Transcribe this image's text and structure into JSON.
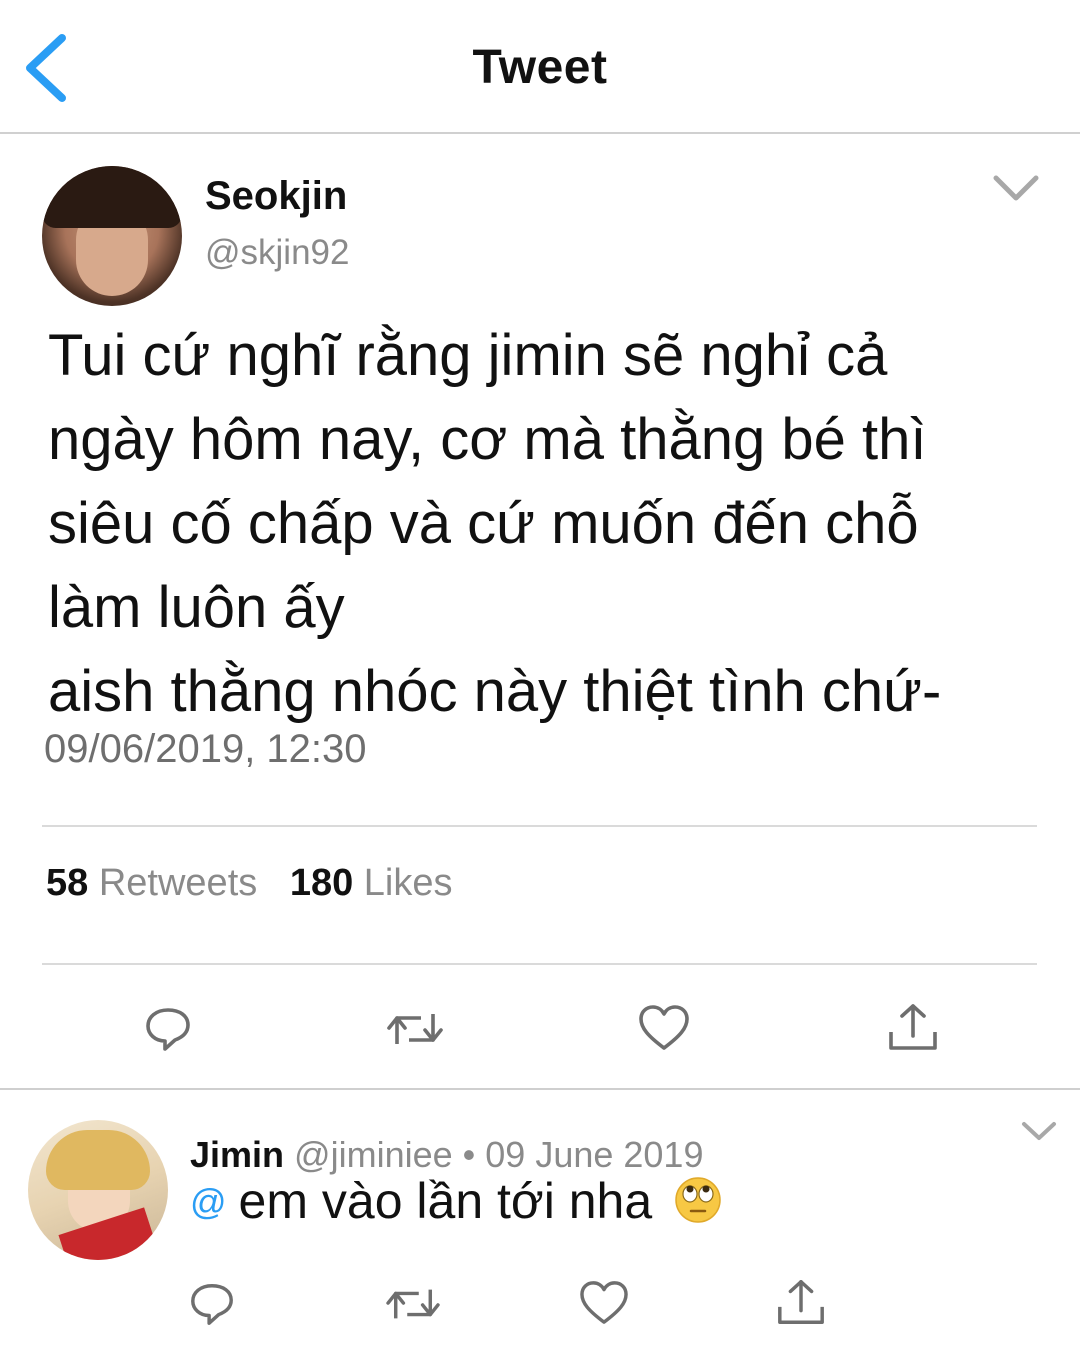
{
  "header": {
    "title": "Tweet"
  },
  "tweet": {
    "author_name": "Seokjin",
    "author_handle": "@skjin92",
    "text_lines": [
      "Tui cứ nghĩ rằng jimin sẽ nghỉ cả",
      "ngày hôm nay, cơ mà thằng bé thì",
      "siêu cố chấp và cứ muốn đến chỗ",
      "làm luôn ấy",
      "aish thằng nhóc này thiệt tình chứ-"
    ],
    "timestamp": "09/06/2019, 12:30",
    "retweets_count": "58",
    "retweets_label": "Retweets",
    "likes_count": "180",
    "likes_label": "Likes"
  },
  "reply": {
    "author_name": "Jimin",
    "author_handle": "@jiminiee",
    "separator": "•",
    "date": "09 June 2019",
    "mention": "@",
    "text": "em vào lần tới nha"
  },
  "icons": {
    "back": "chevron-left-icon",
    "menu": "chevron-down-icon",
    "reply": "speech-bubble-icon",
    "retweet": "retweet-icon",
    "like": "heart-icon",
    "share": "share-icon",
    "emoji": "face-with-rolling-eyes"
  },
  "colors": {
    "accent": "#2a9df4",
    "icon_gray": "#6e6e6e",
    "divider": "#dadada"
  }
}
